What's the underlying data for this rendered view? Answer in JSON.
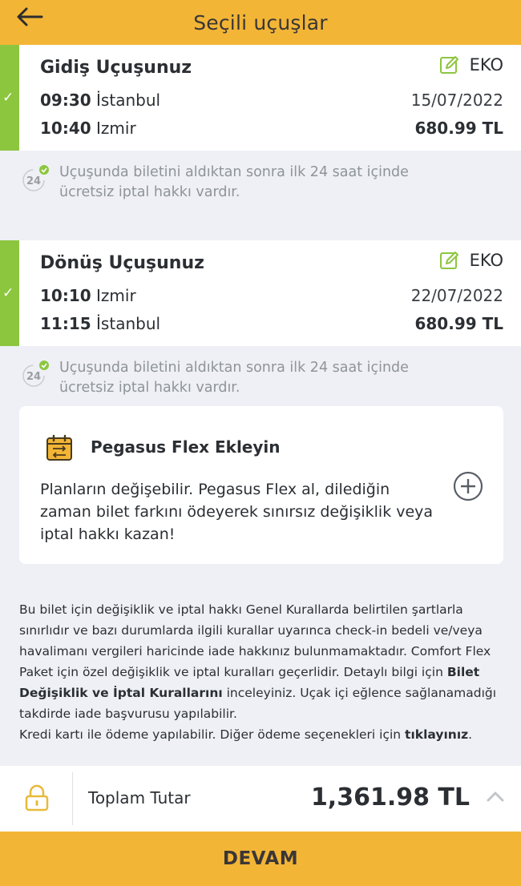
{
  "header": {
    "title": "Seçili uçuşlar"
  },
  "outbound": {
    "title": "Gidiş Uçuşunuz",
    "fare_class": "EKO",
    "dep_time": "09:30",
    "dep_city": "İstanbul",
    "arr_time": "10:40",
    "arr_city": "Izmir",
    "date": "15/07/2022",
    "price": "680.99 TL",
    "notice_line1": "Uçuşunda biletini aldıktan sonra ilk 24 saat içinde",
    "notice_line2": "ücretsiz iptal hakkı vardır."
  },
  "return": {
    "title": "Dönüş Uçuşunuz",
    "fare_class": "EKO",
    "dep_time": "10:10",
    "dep_city": "Izmir",
    "arr_time": "11:15",
    "arr_city": "İstanbul",
    "date": "22/07/2022",
    "price": "680.99 TL",
    "notice_line1": "Uçuşunda biletini aldıktan sonra ilk 24 saat içinde",
    "notice_line2": "ücretsiz iptal hakkı vardır."
  },
  "flex": {
    "title": "Pegasus Flex Ekleyin",
    "description": "Planların değişebilir. Pegasus Flex al, dilediğin zaman bilet farkını ödeyerek sınırsız değişiklik veya iptal hakkı kazan!"
  },
  "rules": {
    "text_part1": "Bu bilet için değişiklik ve iptal hakkı Genel Kurallarda belirtilen şartlarla sınırlıdır ve bazı durumlarda ilgili kurallar uyarınca check-in bedeli ve/veya havalimanı vergileri haricinde iade hakkınız bulunmamaktadır. Comfort Flex Paket için özel değişiklik ve iptal kuralları geçerlidir. Detaylı bilgi için ",
    "link_rules": "Bilet Değişiklik ve İptal Kurallarını",
    "text_part2": " inceleyiniz. Uçak içi eğlence sağlanamadığı takdirde iade başvurusu yapılabilir.",
    "text_part3": "Kredi kartı ile ödeme yapılabilir. Diğer ödeme seçenekleri için ",
    "link_click": "tıklayınız",
    "text_part4": "."
  },
  "total": {
    "label": "Toplam Tutar",
    "amount": "1,361.98 TL"
  },
  "footer": {
    "continue_label": "DEVAM"
  },
  "badge_text": "24",
  "colors": {
    "brand_yellow": "#f2b536",
    "success_green": "#8cc63f",
    "icon_gold": "#e8b93a"
  }
}
